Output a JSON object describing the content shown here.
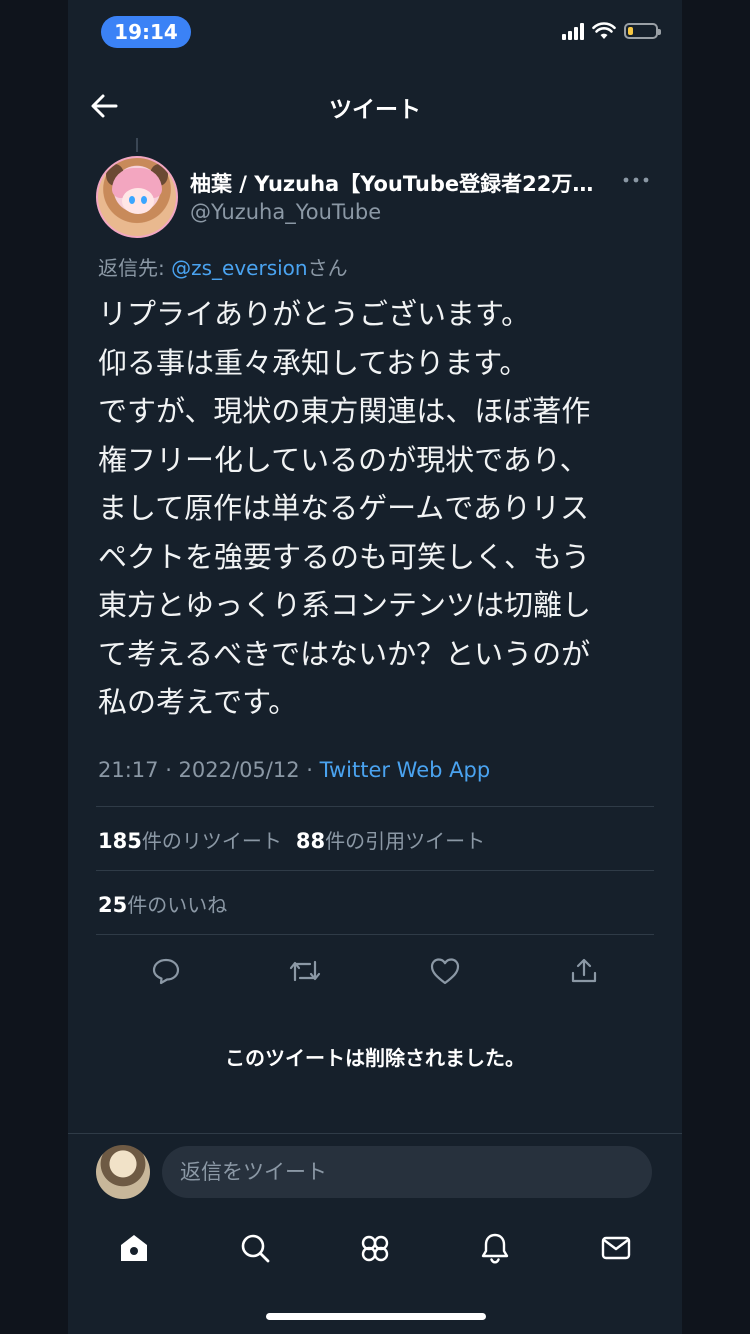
{
  "status_bar": {
    "time": "19:14",
    "battery_level": 0.2
  },
  "header": {
    "title": "ツイート"
  },
  "tweet": {
    "author_name": "柚葉 / Yuzuha【YouTube登録者22万…",
    "author_handle": "@Yuzuha_YouTube",
    "reply_prefix": "返信先: ",
    "reply_mention": "@zs_eversion",
    "reply_suffix": "さん",
    "text": "リプライありがとうございます。\n仰る事は重々承知しております。\nですが、現状の東方関連は、ほぼ著作\n権フリー化しているのが現状であり、\nまして原作は単なるゲームでありリス\nペクトを強要するのも可笑しく、もう\n東方とゆっくり系コンテンツは切離し\nて考えるべきではないか？というのが\n私の考えです。",
    "timestamp": "21:17 · 2022/05/12 · ",
    "source": "Twitter Web App",
    "retweets_count": "185",
    "retweets_label": "件のリツイート",
    "quotes_count": "88",
    "quotes_label": "件の引用ツイート",
    "likes_count": "25",
    "likes_label": "件のいいね"
  },
  "deleted_notice": "このツイートは削除されました。",
  "compose": {
    "placeholder": "返信をツイート"
  },
  "colors": {
    "background": "#16202b",
    "accent": "#4aa3f0",
    "muted": "#8b98a5",
    "time_pill": "#3b82f6"
  },
  "icons": {
    "actions": [
      "reply-icon",
      "retweet-icon",
      "like-icon",
      "share-icon"
    ],
    "tabs": [
      "home-icon",
      "search-icon",
      "communities-icon",
      "notifications-icon",
      "messages-icon"
    ]
  }
}
